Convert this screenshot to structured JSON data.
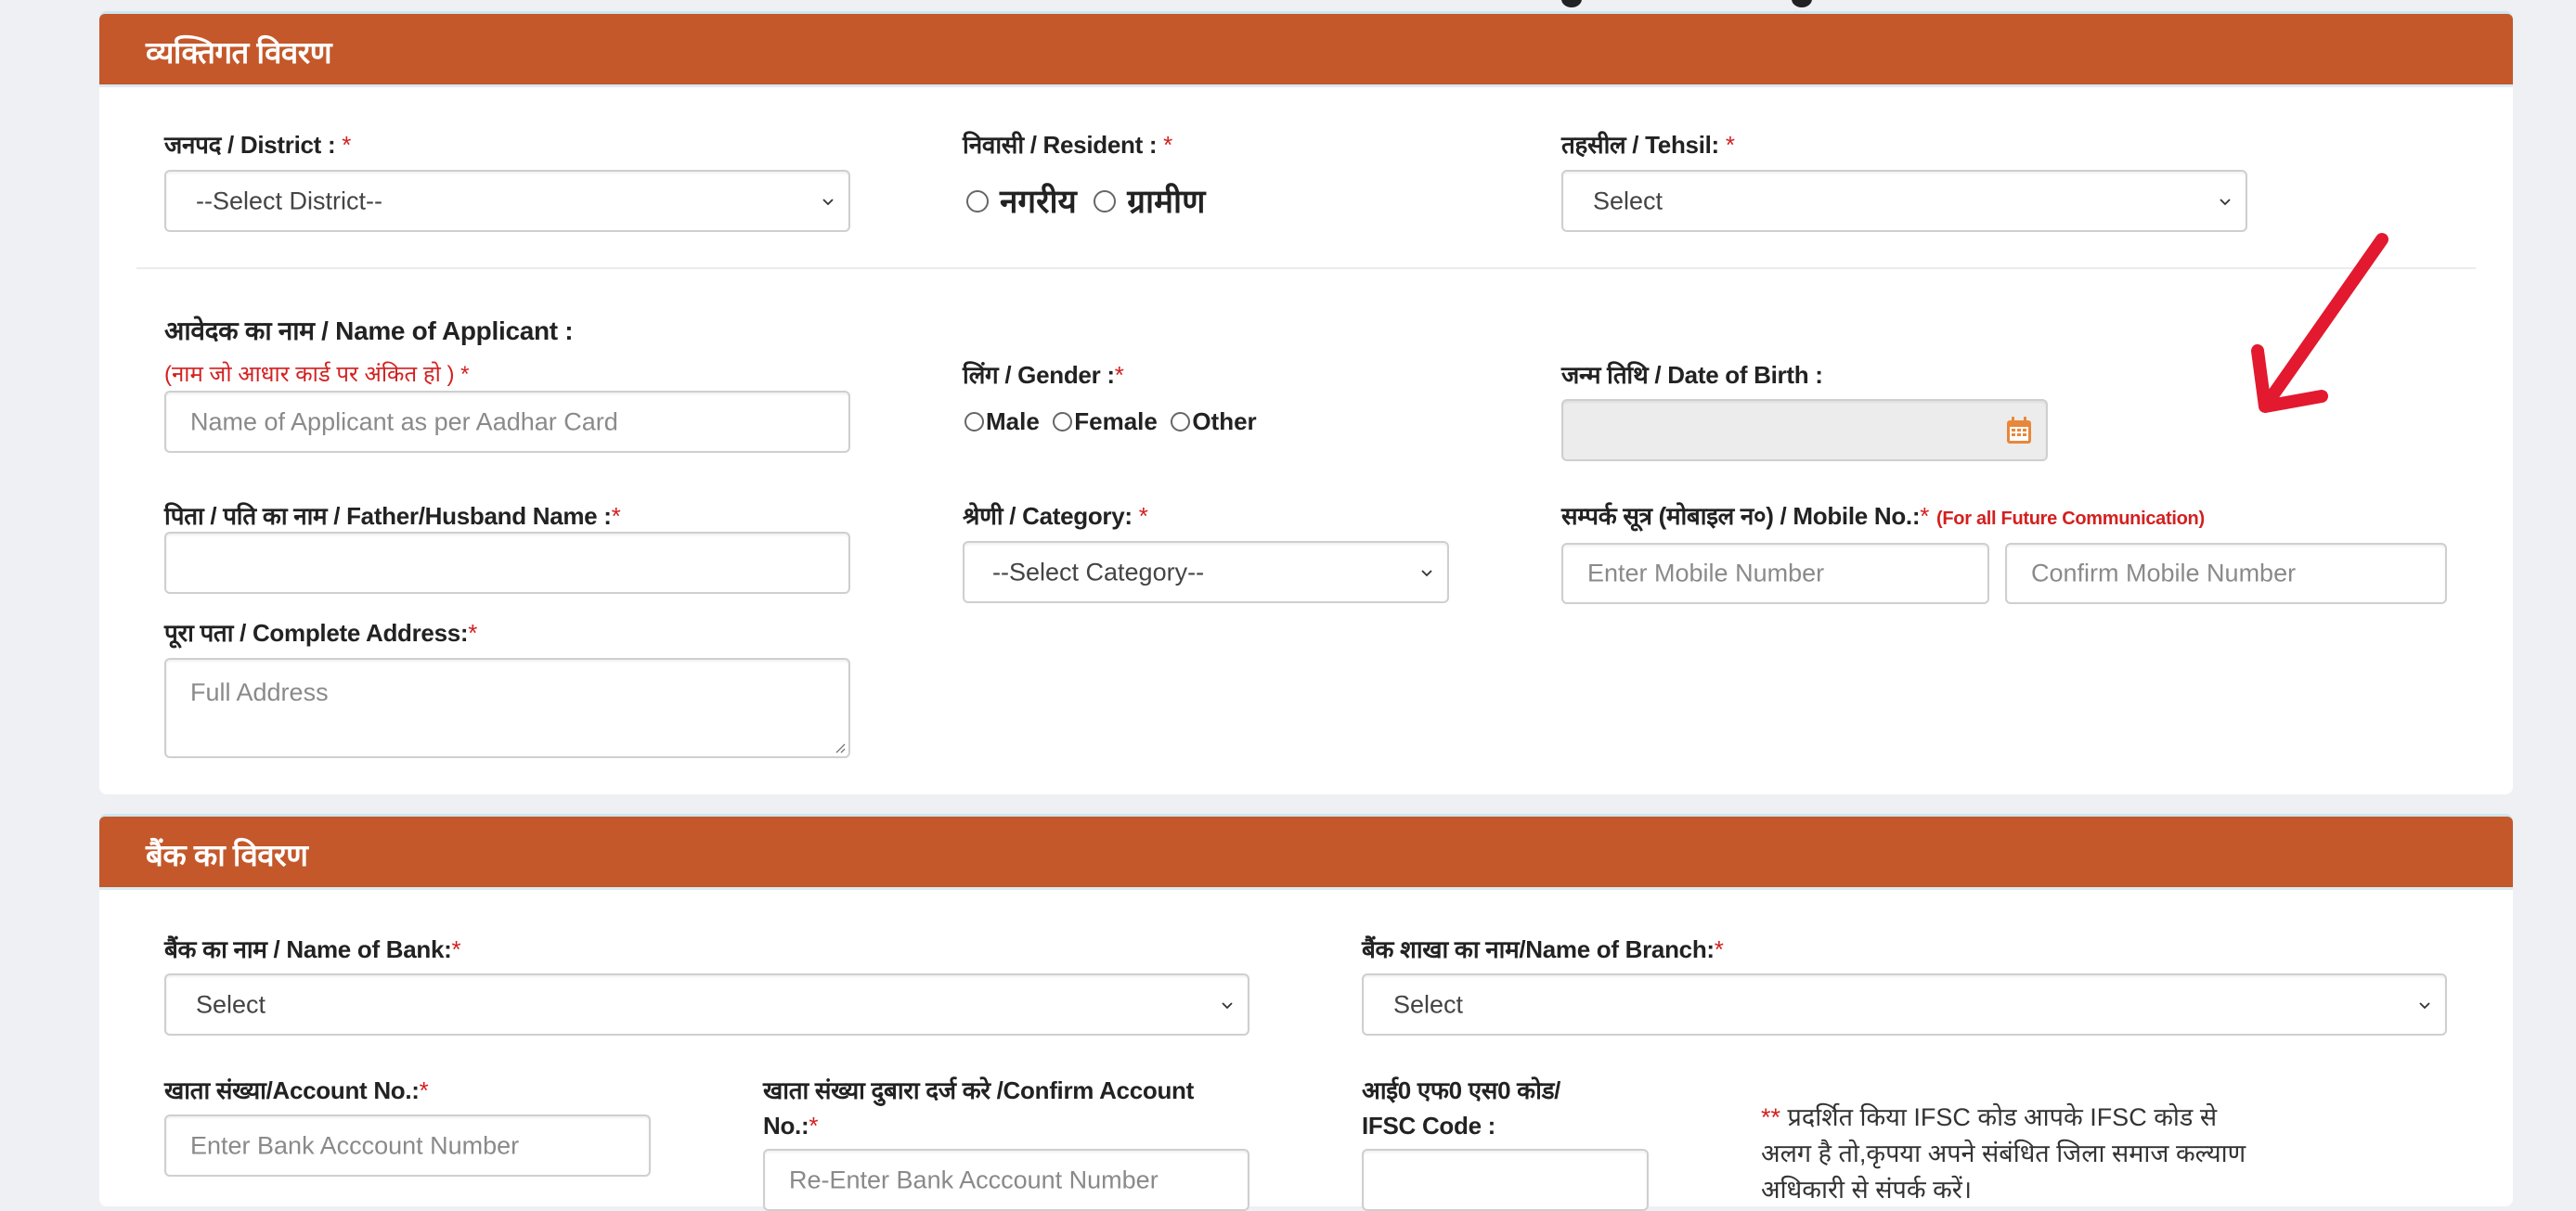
{
  "personal": {
    "header": "व्यक्तिगत विवरण",
    "district": {
      "label": "जनपद / District : ",
      "required": "*",
      "placeholder": "--Select District--"
    },
    "resident": {
      "label": "निवासी / Resident : ",
      "required": "*",
      "options": [
        "नगरीय",
        "ग्रामीण"
      ]
    },
    "tehsil": {
      "label": "तहसील / Tehsil: ",
      "required": "*",
      "placeholder": "Select"
    },
    "applicant": {
      "label": "आवेदक का नाम / Name of Applicant :",
      "hint": "(नाम जो आधार कार्ड पर अंकित हो ) *",
      "placeholder": "Name of Applicant as per Aadhar Card"
    },
    "gender": {
      "label": "लिंग / Gender :",
      "required": "*",
      "options": [
        "Male",
        "Female",
        "Other"
      ]
    },
    "dob": {
      "label": "जन्म तिथि / Date of Birth :",
      "value": ""
    },
    "father": {
      "label": "पिता / पति का नाम / Father/Husband Name :",
      "required": "*",
      "value": ""
    },
    "category": {
      "label": "श्रेणी / Category: ",
      "required": "*",
      "placeholder": "--Select Category--"
    },
    "mobile": {
      "label": "सम्पर्क सूत्र (मोबाइल न०) / Mobile No.:",
      "required": "*",
      "note": "(For all Future Communication)",
      "placeholder": "Enter Mobile Number",
      "confirm_placeholder": "Confirm Mobile Number"
    },
    "address": {
      "label": "पूरा पता / Complete Address:",
      "required": "*",
      "placeholder": "Full Address"
    }
  },
  "bank": {
    "header": "बैंक का विवरण",
    "bank_name": {
      "label": "बैंक का नाम / Name of Bank:",
      "required": "*",
      "placeholder": "Select"
    },
    "branch": {
      "label": "बैंक शाखा का नाम/Name of Branch:",
      "required": "*",
      "placeholder": "Select"
    },
    "account": {
      "label": "खाता संख्या/Account No.:",
      "required": "*",
      "placeholder": "Enter Bank Acccount Number"
    },
    "confirm_account": {
      "label_line1": "खाता संख्या दुबारा दर्ज करे /Confirm Account",
      "label_line2": "No.:",
      "required": "*",
      "placeholder": "Re-Enter Bank Acccount Number"
    },
    "ifsc": {
      "label_line1": "आई0 एफ0 एस0 कोड/",
      "label_line2": "IFSC Code :",
      "value": ""
    },
    "ifsc_note": {
      "marker": "**",
      "text": " प्रदर्शित किया IFSC कोड आपके IFSC कोड से अलग है तो,कृपया अपने संबंधित जिला समाज कल्याण अधिकारी से संपर्क करें।"
    }
  },
  "colors": {
    "header": "#c4582a",
    "required": "#d32020",
    "annotation_arrow": "#e3192f",
    "calendar_icon": "#e8873a"
  }
}
